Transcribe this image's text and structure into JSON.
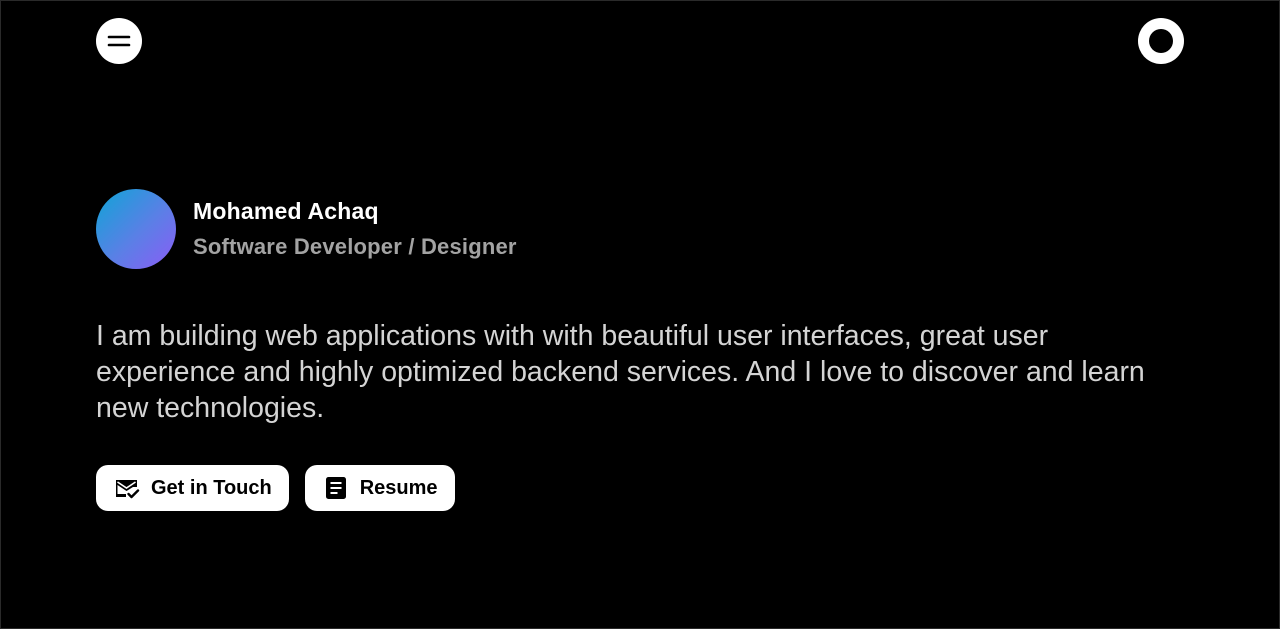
{
  "header": {
    "menu_icon": "menu-lines-icon",
    "theme_icon": "circle-toggle-icon"
  },
  "profile": {
    "name": "Mohamed Achaq",
    "role": "Software Developer / Designer",
    "avatar_gradient": [
      "#0ea5d6",
      "#8b5cf6"
    ]
  },
  "bio": {
    "text": "I am building web applications with with beautiful user interfaces, great user experience and highly optimized backend services. And I love to discover and learn new technologies."
  },
  "actions": {
    "contact": {
      "label": "Get in Touch",
      "icon": "mail-check-icon"
    },
    "resume": {
      "label": "Resume",
      "icon": "document-icon"
    }
  },
  "colors": {
    "background": "#000000",
    "primary_text": "#ffffff",
    "secondary_text": "#a3a3a3",
    "body_text": "#d4d4d4",
    "button_bg": "#ffffff"
  }
}
